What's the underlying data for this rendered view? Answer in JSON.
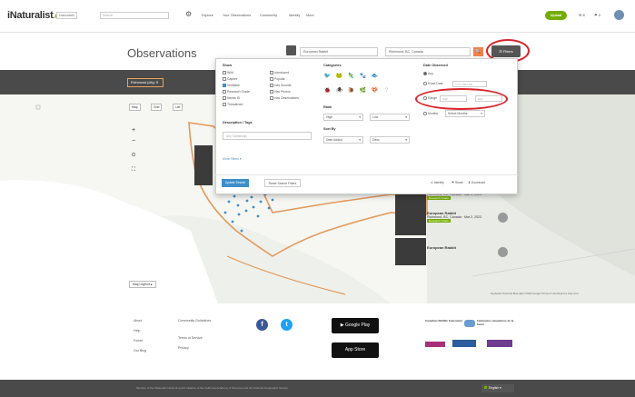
{
  "nav": {
    "logo": "iNaturalist",
    "logo_suffix": ".ca",
    "search_scope": "Naturalists",
    "search_placeholder": "Search",
    "links": [
      "Explore",
      "Your Observations",
      "Community",
      "Identify",
      "More"
    ],
    "upload_label": "Upload",
    "counts": [
      "8",
      "0"
    ]
  },
  "title_bar": {
    "title": "Observations",
    "taxon_value": "European Rabbit",
    "place_value": "Richmond, BC, Canada",
    "filters_label": "Filters"
  },
  "place_chip": "Richmond (city)",
  "map": {
    "tabs": [
      "Map",
      "Grid",
      "List"
    ],
    "zoom_in": "+",
    "zoom_out": "−",
    "legend_label": "Map Legend",
    "attribution": "Keyboard shortcuts   Map data ©2023 Google   Terms of Use   Report a map error"
  },
  "panel": {
    "show_heading": "Show",
    "show_col1": [
      "Wild",
      "Captive",
      "Verifiable",
      "Research Grade",
      "Needs ID",
      "Threatened"
    ],
    "show_col1_checked": [
      false,
      false,
      true,
      false,
      false,
      false
    ],
    "show_col2": [
      "Introduced",
      "Popular",
      "Has Sounds",
      "Has Photos",
      "Has Observations"
    ],
    "categories_heading": "Categories",
    "rank_heading": "Rank",
    "rank_high": "High",
    "rank_low": "Low",
    "sort_heading": "Sort By",
    "sort_by": "Date Added",
    "sort_order": "Desc",
    "desc_heading": "Description / Tags",
    "desc_placeholder": "Any Substrings",
    "more_filters": "More Filters",
    "date_heading": "Date Observed",
    "date_any": "Any",
    "date_exact": "Exact Date",
    "date_exact_placeholder": "YYYY-MM-DD",
    "date_range": "Range",
    "date_start": "Start",
    "date_end": "End",
    "date_months": "Months",
    "months_value": "Select Months",
    "update_btn": "Update Search",
    "reset_btn": "Reset Search Filters",
    "footer_links": [
      "Identify",
      "Share",
      "Download"
    ]
  },
  "cards": [
    {
      "name": "European Rabbit",
      "meta": "Richmond, BC, Canada",
      "date": "Mar 2, 2023",
      "badge": "Research Grade"
    },
    {
      "name": "European Rabbit",
      "meta": "Richmond, BC, Canada",
      "date": "Mar 2, 2023",
      "badge": "Research Grade"
    },
    {
      "name": "European Rabbit",
      "meta": "",
      "date": "",
      "badge": ""
    }
  ],
  "footer": {
    "col1": [
      "About",
      "Help",
      "Forum",
      "Our Blog"
    ],
    "col2": [
      "Community Guidelines",
      "Terms of Service",
      "Privacy"
    ],
    "google_play": "Google Play",
    "app_store": "App Store",
    "partners_1": "Canadian Wildlife Federation",
    "partners_2": "Fédération canadienne de la faune",
    "bottom_text": "Member of the iNaturalist Network   a joint initiative of the California Academy of Sciences and the National Geographic Society",
    "language": "English"
  },
  "colors": {
    "brand_green": "#74ac00",
    "accent_orange": "#f5824c",
    "highlight_red": "#d9232a",
    "link_blue": "#3d8fc9"
  }
}
